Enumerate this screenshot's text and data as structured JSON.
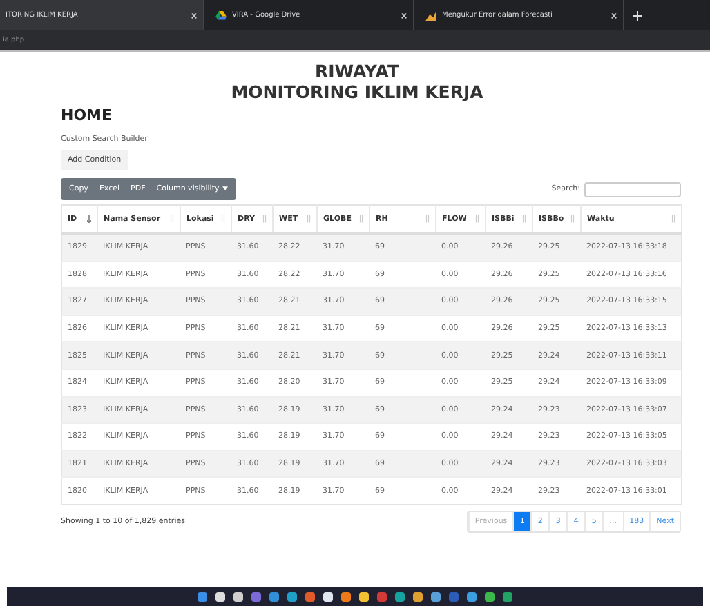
{
  "browser": {
    "tabs": [
      {
        "title": "ITORING IKLIM KERJA",
        "selected": true
      },
      {
        "title": "VIRA - Google Drive",
        "selected": false
      },
      {
        "title": "Mengukur Error dalam Forecasti",
        "selected": false
      }
    ],
    "address": "ia.php"
  },
  "page": {
    "title_lines": [
      "RIWAYAT",
      "MONITORING IKLIM KERJA"
    ],
    "heading": "HOME",
    "search_builder": {
      "label": "Custom Search Builder",
      "button": "Add Condition"
    }
  },
  "toolbar": {
    "buttons": [
      "Copy",
      "Excel",
      "PDF",
      "Column visibility"
    ],
    "search_label": "Search:"
  },
  "table": {
    "columns": [
      {
        "label": "ID",
        "sorted": true
      },
      {
        "label": "Nama Sensor",
        "sorted": false
      },
      {
        "label": "Lokasi",
        "sorted": false
      },
      {
        "label": "DRY",
        "sorted": false
      },
      {
        "label": "WET",
        "sorted": false
      },
      {
        "label": "GLOBE",
        "sorted": false
      },
      {
        "label": "RH",
        "sorted": false
      },
      {
        "label": "FLOW",
        "sorted": false
      },
      {
        "label": "ISBBi",
        "sorted": false
      },
      {
        "label": "ISBBo",
        "sorted": false
      },
      {
        "label": "Waktu",
        "sorted": false
      }
    ],
    "rows": [
      [
        "1829",
        "IKLIM KERJA",
        "PPNS",
        "31.60",
        "28.22",
        "31.70",
        "69",
        "0.00",
        "29.26",
        "29.25",
        "2022-07-13 16:33:18"
      ],
      [
        "1828",
        "IKLIM KERJA",
        "PPNS",
        "31.60",
        "28.22",
        "31.70",
        "69",
        "0.00",
        "29.26",
        "29.25",
        "2022-07-13 16:33:16"
      ],
      [
        "1827",
        "IKLIM KERJA",
        "PPNS",
        "31.60",
        "28.21",
        "31.70",
        "69",
        "0.00",
        "29.26",
        "29.25",
        "2022-07-13 16:33:15"
      ],
      [
        "1826",
        "IKLIM KERJA",
        "PPNS",
        "31.60",
        "28.21",
        "31.70",
        "69",
        "0.00",
        "29.26",
        "29.25",
        "2022-07-13 16:33:13"
      ],
      [
        "1825",
        "IKLIM KERJA",
        "PPNS",
        "31.60",
        "28.21",
        "31.70",
        "69",
        "0.00",
        "29.25",
        "29.24",
        "2022-07-13 16:33:11"
      ],
      [
        "1824",
        "IKLIM KERJA",
        "PPNS",
        "31.60",
        "28.20",
        "31.70",
        "69",
        "0.00",
        "29.25",
        "29.24",
        "2022-07-13 16:33:09"
      ],
      [
        "1823",
        "IKLIM KERJA",
        "PPNS",
        "31.60",
        "28.19",
        "31.70",
        "69",
        "0.00",
        "29.24",
        "29.23",
        "2022-07-13 16:33:07"
      ],
      [
        "1822",
        "IKLIM KERJA",
        "PPNS",
        "31.60",
        "28.19",
        "31.70",
        "69",
        "0.00",
        "29.24",
        "29.23",
        "2022-07-13 16:33:05"
      ],
      [
        "1821",
        "IKLIM KERJA",
        "PPNS",
        "31.60",
        "28.19",
        "31.70",
        "69",
        "0.00",
        "29.24",
        "29.23",
        "2022-07-13 16:33:03"
      ],
      [
        "1820",
        "IKLIM KERJA",
        "PPNS",
        "31.60",
        "28.19",
        "31.70",
        "69",
        "0.00",
        "29.24",
        "29.23",
        "2022-07-13 16:33:01"
      ]
    ]
  },
  "footer": {
    "info": "Showing 1 to 10 of 1,829 entries",
    "pagination": [
      {
        "label": "Previous",
        "selected": false,
        "disabled": true
      },
      {
        "label": "1",
        "selected": true,
        "disabled": false
      },
      {
        "label": "2",
        "selected": false,
        "disabled": false
      },
      {
        "label": "3",
        "selected": false,
        "disabled": false
      },
      {
        "label": "4",
        "selected": false,
        "disabled": false
      },
      {
        "label": "5",
        "selected": false,
        "disabled": false
      },
      {
        "label": "…",
        "selected": false,
        "disabled": true
      },
      {
        "label": "183",
        "selected": false,
        "disabled": false
      },
      {
        "label": "Next",
        "selected": false,
        "disabled": false
      }
    ]
  },
  "taskbar": {
    "icons": [
      {
        "color": "#3a8ee6"
      },
      {
        "color": "#dddddd"
      },
      {
        "color": "#cfcfcf"
      },
      {
        "color": "#7b6bd6"
      },
      {
        "color": "#2f8fd8"
      },
      {
        "color": "#1fa0c8"
      },
      {
        "color": "#e05a2a"
      },
      {
        "color": "#dfe6ef"
      },
      {
        "color": "#f07a1a"
      },
      {
        "color": "#f2c230"
      },
      {
        "color": "#d23a3a"
      },
      {
        "color": "#17a2a0"
      },
      {
        "color": "#e0a030"
      },
      {
        "color": "#5aa0d8"
      },
      {
        "color": "#2b5cb8"
      },
      {
        "color": "#3a9ee0"
      },
      {
        "color": "#3cb84a"
      },
      {
        "color": "#21a366"
      }
    ]
  }
}
